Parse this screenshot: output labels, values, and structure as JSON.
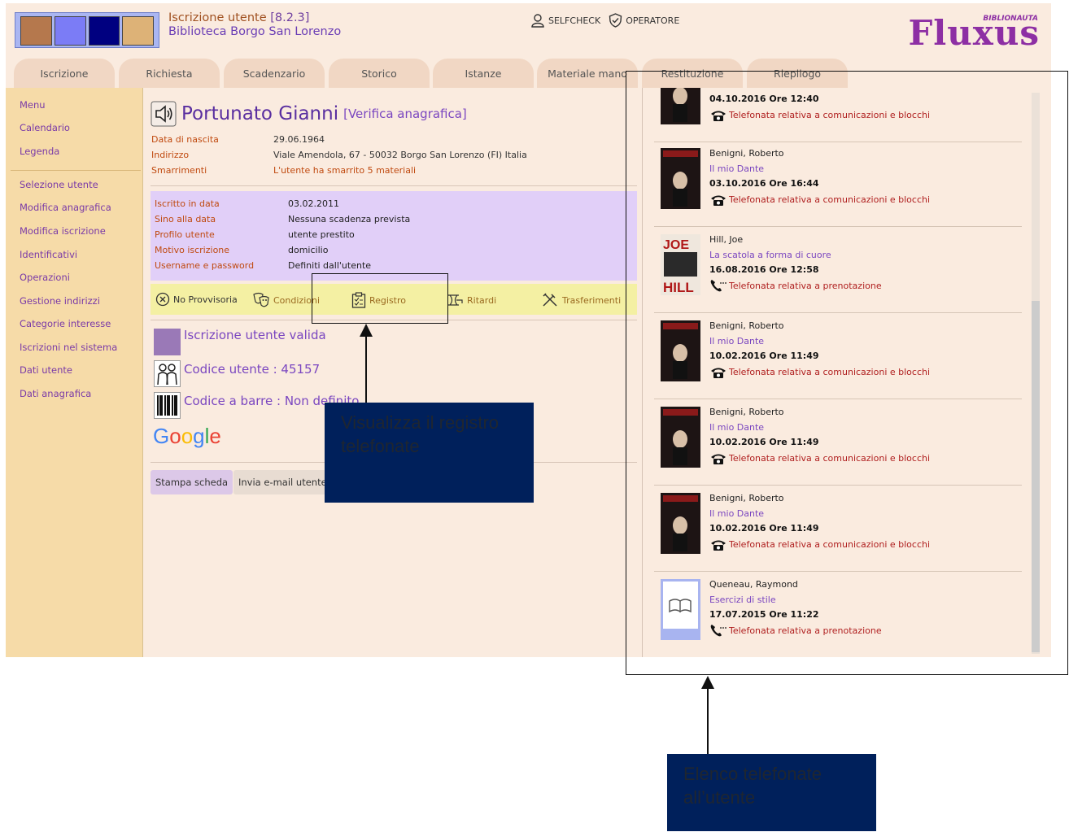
{
  "header": {
    "module_title": "Iscrizione utente",
    "version": "[8.2.3]",
    "library": "Biblioteca Borgo San Lorenzo",
    "selfcheck_label": "SELFCHECK",
    "operator_label": "OPERATORE",
    "logo_text": "Fluxus",
    "logo_sub": "BIBLIONAUTA",
    "swatch_colors": [
      "#b5784d",
      "#7b7cf6",
      "#000080",
      "#ddb277"
    ]
  },
  "tabs": [
    "Iscrizione",
    "Richiesta",
    "Scadenzario",
    "Storico",
    "Istanze",
    "Materiale mano",
    "Restituzione",
    "Riepilogo"
  ],
  "sidebar": {
    "group1": [
      "Menu",
      "Calendario",
      "Legenda"
    ],
    "group2": [
      "Selezione utente",
      "Modifica anagrafica",
      "Modifica iscrizione",
      "Identificativi",
      "Operazioni",
      "Gestione indirizzi",
      "Categorie interesse",
      "Iscrizioni nel sistema",
      "Dati utente",
      "Dati anagrafica"
    ]
  },
  "user": {
    "name": "Portunato Gianni",
    "verifica": "[Verifica anagrafica]",
    "fields": [
      {
        "label": "Data di nascita",
        "value": "29.06.1964"
      },
      {
        "label": "Indirizzo",
        "value": "Viale Amendola, 67 - 50032 Borgo San Lorenzo (FI) Italia"
      },
      {
        "label": "Smarrimenti",
        "value": "L'utente ha smarrito 5 materiali"
      }
    ]
  },
  "iscrizione": [
    {
      "label": "Iscritto in data",
      "value": "03.02.2011"
    },
    {
      "label": "Sino alla data",
      "value": "Nessuna scadenza prevista"
    },
    {
      "label": "Profilo utente",
      "value": "utente prestito"
    },
    {
      "label": "Motivo iscrizione",
      "value": "domicilio"
    },
    {
      "label": "Username e password",
      "value": "Definiti dall'utente"
    }
  ],
  "actions": {
    "no_provvisoria": "No Provvisoria",
    "condizioni": "Condizioni",
    "registro": "Registro",
    "ritardi": "Ritardi",
    "trasferimenti": "Trasferimenti"
  },
  "status": {
    "valid": "Iscrizione utente valida",
    "code_label": "Codice utente : 45157",
    "barcode_label": "Codice a barre : Non definito"
  },
  "buttons": {
    "print": "Stampa scheda",
    "email": "Invia e-mail utente"
  },
  "calls": [
    {
      "author": "",
      "title": "",
      "date": "04.10.2016 Ore 12:40",
      "type": "Telefonata relativa a comunicazioni e blocchi",
      "icon": "dark-book"
    },
    {
      "author": "Benigni, Roberto",
      "title": "Il mio Dante",
      "date": "03.10.2016 Ore 16:44",
      "type": "Telefonata relativa a comunicazioni e blocchi",
      "icon": "dark-book"
    },
    {
      "author": "Hill, Joe",
      "title": "La scatola a forma di cuore",
      "date": "16.08.2016 Ore 12:58",
      "type": "Telefonata relativa a prenotazione",
      "icon": "joe-hill"
    },
    {
      "author": "Benigni, Roberto",
      "title": "Il mio Dante",
      "date": "10.02.2016 Ore 11:49",
      "type": "Telefonata relativa a comunicazioni e blocchi",
      "icon": "dark-book"
    },
    {
      "author": "Benigni, Roberto",
      "title": "Il mio Dante",
      "date": "10.02.2016 Ore 11:49",
      "type": "Telefonata relativa a comunicazioni e blocchi",
      "icon": "dark-book"
    },
    {
      "author": "Benigni, Roberto",
      "title": "Il mio Dante",
      "date": "10.02.2016 Ore 11:49",
      "type": "Telefonata relativa a comunicazioni e blocchi",
      "icon": "dark-book"
    },
    {
      "author": "Queneau, Raymond",
      "title": "Esercizi di stile",
      "date": "17.07.2015 Ore 11:22",
      "type": "Telefonata relativa a prenotazione",
      "icon": "generic-book"
    }
  ],
  "callouts": {
    "registro": "Visualizza il registro telefonate",
    "elenco": "Elenco telefonate all’utente"
  },
  "google": "Google"
}
